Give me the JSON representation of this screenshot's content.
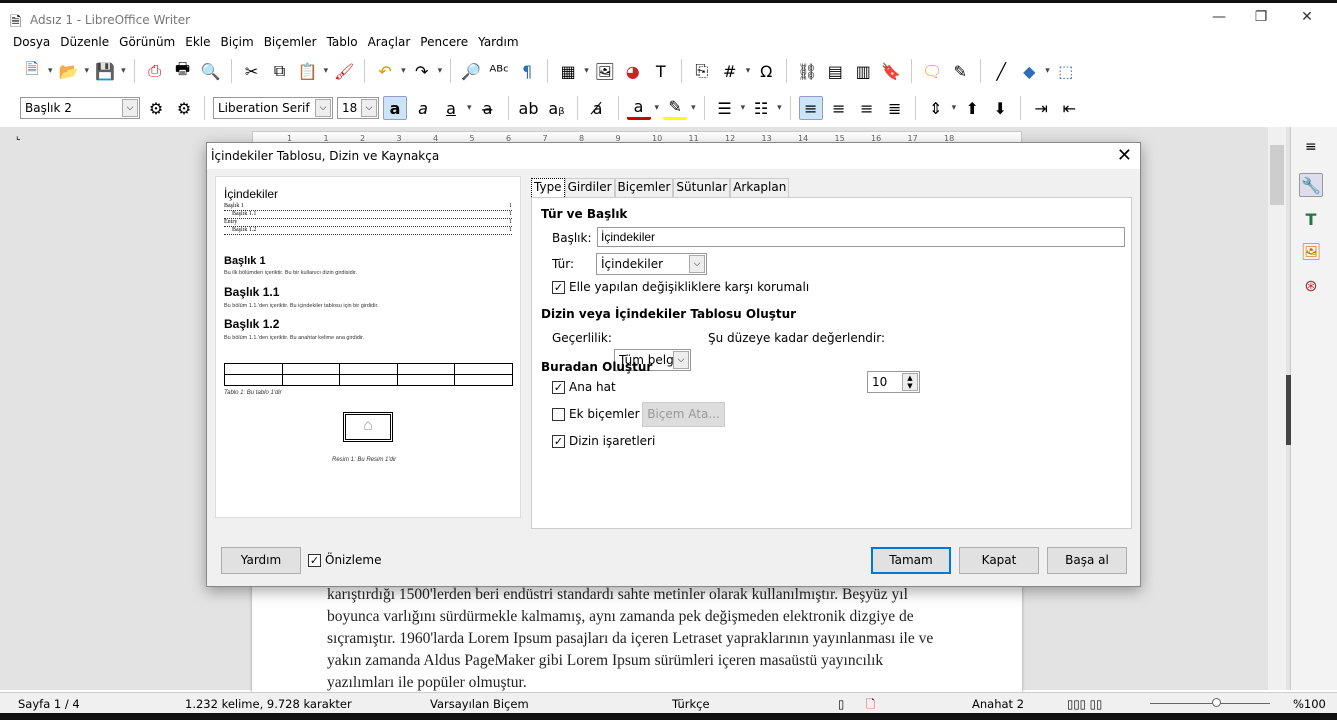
{
  "window": {
    "title": "Adsız 1 - LibreOffice Writer",
    "minimize": "—",
    "maximize": "❐",
    "close": "✕"
  },
  "menu": [
    "Dosya",
    "Düzenle",
    "Görünüm",
    "Ekle",
    "Biçim",
    "Biçemler",
    "Tablo",
    "Araçlar",
    "Pencere",
    "Yardım"
  ],
  "toolbar1": [
    "new-document-icon",
    "|dd",
    "open-folder-icon",
    "|dd",
    "save-icon",
    "|dd",
    "sep",
    "export-pdf-icon",
    "print-icon",
    "print-preview-icon",
    "sep",
    "cut-icon",
    "copy-icon",
    "paste-icon",
    "|dd",
    "clone-formatting-icon",
    "sep",
    "undo-icon",
    "|dd",
    "redo-icon",
    "|dd",
    "sep",
    "find-replace-icon",
    "spelling-icon",
    "formatting-marks-icon",
    "sep",
    "insert-table-icon",
    "|dd",
    "insert-image-icon",
    "insert-chart-icon",
    "insert-textbox-icon",
    "sep",
    "page-break-icon",
    "insert-field-icon",
    "|dd",
    "special-character-icon",
    "sep",
    "hyperlink-icon",
    "footnote-icon",
    "endnote-icon",
    "bookmark-icon",
    "sep",
    "comment-icon",
    "track-changes-icon",
    "sep",
    "line-icon",
    "basic-shapes-icon",
    "|dd",
    "draw-functions-icon"
  ],
  "toolbar1_glyphs": {
    "new-document-icon": "🗎",
    "open-folder-icon": "📂",
    "save-icon": "💾",
    "export-pdf-icon": "⎙",
    "print-icon": "🖶",
    "print-preview-icon": "🔍",
    "cut-icon": "✂",
    "copy-icon": "⧉",
    "paste-icon": "📋",
    "clone-formatting-icon": "🖌",
    "undo-icon": "↶",
    "redo-icon": "↷",
    "find-replace-icon": "🔎",
    "spelling-icon": "ᴬᴮᶜ",
    "formatting-marks-icon": "¶",
    "insert-table-icon": "▦",
    "insert-image-icon": "🖼",
    "insert-chart-icon": "◕",
    "insert-textbox-icon": "T",
    "page-break-icon": "⎘",
    "insert-field-icon": "#",
    "special-character-icon": "Ω",
    "hyperlink-icon": "⛓",
    "footnote-icon": "▤",
    "endnote-icon": "▥",
    "bookmark-icon": "🔖",
    "comment-icon": "🗨",
    "track-changes-icon": "✎",
    "line-icon": "╱",
    "basic-shapes-icon": "◆",
    "draw-functions-icon": "⬚"
  },
  "toolbar2": {
    "paragraph_style": "Başlık 2",
    "font_name": "Liberation Serif",
    "font_size": "18",
    "icons": [
      "bold-icon",
      "italic-icon",
      "underline-icon",
      "|dd",
      "strikethrough-icon",
      "sep",
      "superscript-icon",
      "subscript-icon",
      "sep",
      "clear-formatting-icon",
      "sep",
      "font-color-icon",
      "|dd",
      "highlight-icon",
      "|dd",
      "sep",
      "unordered-list-icon",
      "|dd",
      "ordered-list-icon",
      "|dd",
      "sep",
      "align-left-icon",
      "align-center-icon",
      "align-right-icon",
      "justify-icon",
      "sep",
      "line-spacing-icon",
      "|dd",
      "increase-paragraph-spacing-icon",
      "decrease-paragraph-spacing-icon",
      "sep",
      "increase-indent-icon",
      "decrease-indent-icon"
    ],
    "glyphs": {
      "bold-icon": "a",
      "italic-icon": "a",
      "underline-icon": "a",
      "strikethrough-icon": "a̶",
      "superscript-icon": "ab",
      "subscript-icon": "aᵦ",
      "clear-formatting-icon": "a̸",
      "font-color-icon": "a",
      "highlight-icon": "✎",
      "unordered-list-icon": "☰",
      "ordered-list-icon": "☷",
      "align-left-icon": "≡",
      "align-center-icon": "≡",
      "align-right-icon": "≡",
      "justify-icon": "≣",
      "line-spacing-icon": "⇕",
      "increase-paragraph-spacing-icon": "⬆",
      "decrease-paragraph-spacing-icon": "⬇",
      "increase-indent-icon": "⇥",
      "decrease-indent-icon": "⇤"
    }
  },
  "ruler": [
    "1",
    "1",
    "2",
    "3",
    "4",
    "5",
    "6",
    "7",
    "8",
    "9",
    "10",
    "11",
    "12",
    "13",
    "14",
    "15",
    "16",
    "17",
    "18"
  ],
  "document": {
    "text": "karıştırdığı 1500'lerden beri endüstri standardı sahte metinler olarak kullanılmıştır. Beşyüz yıl boyunca varlığını sürdürmekle kalmamış, aynı zamanda pek değişmeden elektronik dizgiye de sıçramıştır. 1960'larda Lorem Ipsum pasajları da içeren Letraset yapraklarının yayınlanması ile ve yakın zamanda Aldus PageMaker gibi Lorem Ipsum sürümleri içeren masaüstü yayıncılık yazılımları ile popüler olmuştur."
  },
  "sidebar": [
    "properties-icon",
    "styles-icon",
    "gallery-icon",
    "navigator-icon"
  ],
  "statusbar": {
    "page": "Sayfa 1 / 4",
    "words": "1.232 kelime, 9.728 karakter",
    "page_style": "Varsayılan Biçem",
    "language": "Türkçe",
    "outline": "Anahat 2",
    "zoom": "%100"
  },
  "dialog": {
    "title": "İçindekiler Tablosu, Dizin ve Kaynakça",
    "preview": {
      "toc_title": "İçindekiler",
      "toc_entries": [
        {
          "text": "Başlık 1",
          "page": "1"
        },
        {
          "text": "Başlık 1.1",
          "page": "1"
        },
        {
          "text": "Entry",
          "page": "1"
        },
        {
          "text": "Başlık 1.2",
          "page": "1"
        }
      ],
      "sections": [
        {
          "heading": "Başlık 1",
          "body": "Bu ilk bölümden içeriktir. Bu bir kullanıcı dizin girdisidir."
        },
        {
          "heading": "Başlık 1.1",
          "body": "Bu bölüm 1.1.'den içeriktir. Bu içindekiler tablosu için bir girdidir."
        },
        {
          "heading": "Başlık 1.2",
          "body": "Bu bölüm 1.1.'den içeriktir. Bu anahtar kelime ana girdidir."
        }
      ],
      "table_caption": "Tablo 1: Bu tablo 1'dir",
      "image_caption": "Resim 1: Bu Resim 1'dir"
    },
    "tabs": [
      "Type",
      "Girdiler",
      "Biçemler",
      "Sütunlar",
      "Arkaplan"
    ],
    "type_tab": {
      "section1": "Tür ve Başlık",
      "title_label": "Başlık:",
      "title_value": "İçindekiler",
      "type_label": "Tür:",
      "type_value": "İçindekiler",
      "protect_label": "Elle yapılan değişikliklere karşı korumalı",
      "protect_checked": true,
      "section2": "Dizin veya İçindekiler Tablosu Oluştur",
      "scope_label": "Geçerlilik:",
      "scope_value": "Tüm belge",
      "level_label": "Şu düzeye kadar değerlendir:",
      "level_value": "10",
      "section3": "Buradan Oluştur",
      "outline_label": "Ana hat",
      "outline_checked": true,
      "styles_label": "Ek biçemler",
      "styles_checked": false,
      "assign_styles": "Biçem Ata...",
      "marks_label": "Dizin işaretleri",
      "marks_checked": true
    },
    "help": "Yardım",
    "preview_label": "Önizleme",
    "preview_checked": true,
    "ok": "Tamam",
    "close": "Kapat",
    "reset": "Başa al"
  }
}
